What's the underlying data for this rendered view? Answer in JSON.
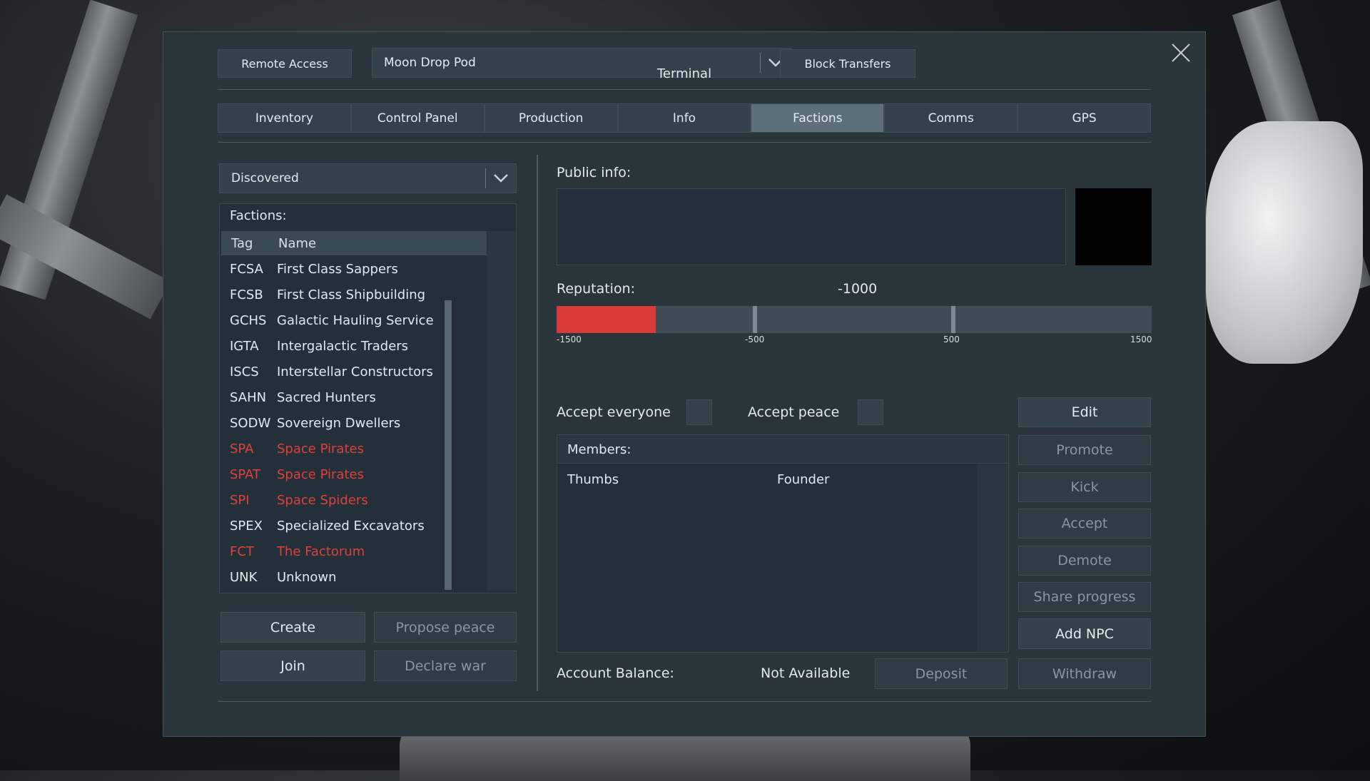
{
  "header": {
    "remote_access": "Remote Access",
    "grid_select": "Moon Drop Pod",
    "title": "Terminal",
    "block_transfers": "Block Transfers"
  },
  "tabs": [
    {
      "label": "Inventory"
    },
    {
      "label": "Control Panel"
    },
    {
      "label": "Production"
    },
    {
      "label": "Info"
    },
    {
      "label": "Factions",
      "active": true
    },
    {
      "label": "Comms"
    },
    {
      "label": "GPS"
    }
  ],
  "filter": {
    "selected": "Discovered"
  },
  "factions": {
    "heading": "Factions:",
    "col_tag": "Tag",
    "col_name": "Name",
    "rows": [
      {
        "tag": "FCSA",
        "name": "First Class Sappers",
        "hostile": false
      },
      {
        "tag": "FCSB",
        "name": "First Class Shipbuilding",
        "hostile": false
      },
      {
        "tag": "GCHS",
        "name": "Galactic Hauling Service",
        "hostile": false
      },
      {
        "tag": "IGTA",
        "name": "Intergalactic Traders",
        "hostile": false
      },
      {
        "tag": "ISCS",
        "name": "Interstellar Constructors",
        "hostile": false
      },
      {
        "tag": "SAHN",
        "name": "Sacred Hunters",
        "hostile": false
      },
      {
        "tag": "SODW",
        "name": "Sovereign Dwellers",
        "hostile": false
      },
      {
        "tag": "SPA",
        "name": "Space Pirates",
        "hostile": true
      },
      {
        "tag": "SPAT",
        "name": "Space Pirates",
        "hostile": true
      },
      {
        "tag": "SPI",
        "name": "Space Spiders",
        "hostile": true
      },
      {
        "tag": "SPEX",
        "name": "Specialized Excavators",
        "hostile": false
      },
      {
        "tag": "FCT",
        "name": "The Factorum",
        "hostile": true
      },
      {
        "tag": "UNK",
        "name": "Unknown",
        "hostile": false
      }
    ],
    "scroll_fraction": 0.8
  },
  "left_buttons": {
    "create": "Create",
    "propose_peace": "Propose peace",
    "join": "Join",
    "declare_war": "Declare war"
  },
  "details": {
    "public_info_label": "Public info:",
    "reputation_label": "Reputation:",
    "reputation_value": "-1000",
    "reputation": {
      "min": -1500,
      "max": 1500,
      "value": -1000,
      "markers": [
        -500,
        500
      ]
    },
    "ticks": [
      "-1500",
      "-500",
      "500",
      "1500"
    ],
    "fill_color": "#d93a3a",
    "accept_everyone": "Accept everyone",
    "accept_peace": "Accept peace",
    "members_label": "Members:",
    "members": [
      {
        "name": "Thumbs",
        "rank": "Founder"
      }
    ],
    "account_balance_label": "Account Balance:",
    "account_balance_value": "Not Available"
  },
  "right_buttons": {
    "edit": "Edit",
    "promote": "Promote",
    "kick": "Kick",
    "accept": "Accept",
    "demote": "Demote",
    "share_progress": "Share progress",
    "add_npc": "Add NPC",
    "deposit": "Deposit",
    "withdraw": "Withdraw"
  }
}
